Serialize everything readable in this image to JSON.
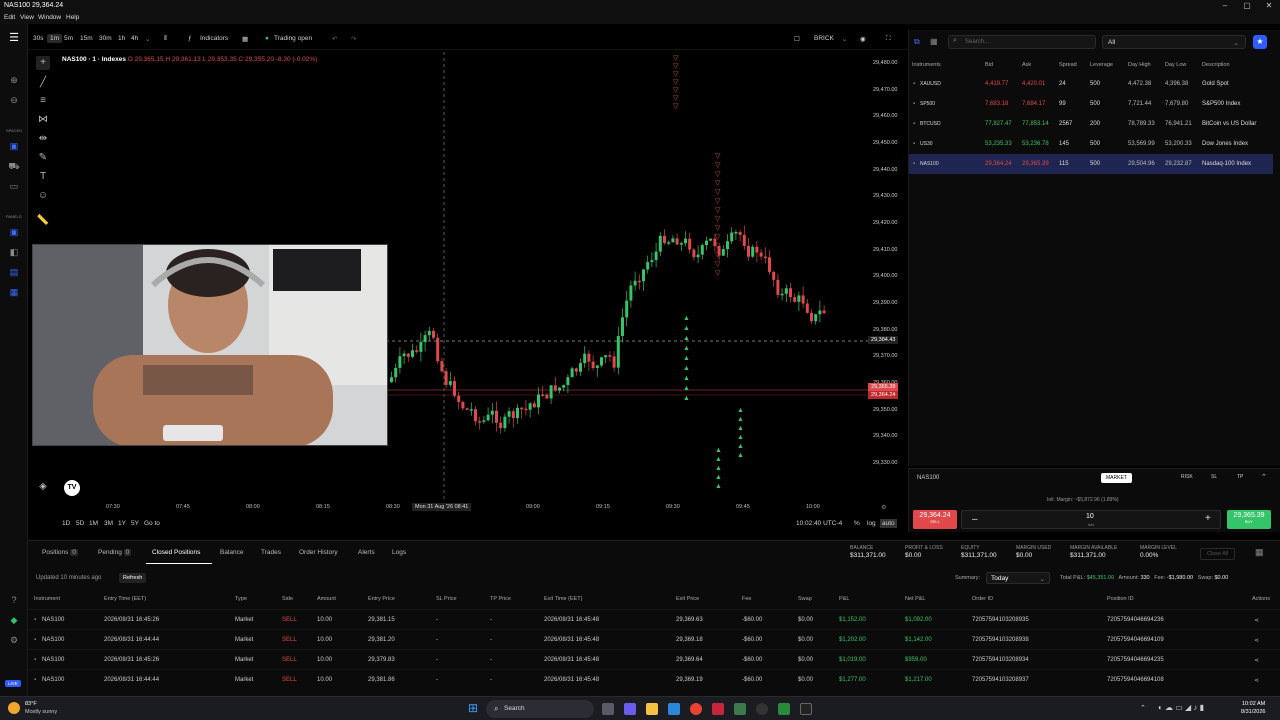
{
  "window": {
    "title": "NAS100 29,364.24"
  },
  "menu": [
    "Edit",
    "View",
    "Window",
    "Help"
  ],
  "sidebar": {
    "labels": [
      "SPACES",
      "PANELS",
      "LIVE"
    ]
  },
  "toolbar": {
    "timeframes": [
      "30s",
      "1m",
      "5m",
      "15m",
      "30m",
      "1h",
      "4h"
    ],
    "selected_timeframe": "1m",
    "indicators_label": "Indicators",
    "status_label": "Trading open",
    "chart_type": "BRICK"
  },
  "chart": {
    "symbol_label": "NAS100 · 1 · Indexes",
    "ohlc": {
      "o": "O 29,365.15",
      "h": "H 29,361.13",
      "l": "L 29,353.35",
      "c": "C 29,355.20",
      "chg": "-8.30 (-0.02%)"
    },
    "price_ticks": [
      "29,480.00",
      "29,470.00",
      "29,460.00",
      "29,450.00",
      "29,440.00",
      "29,430.00",
      "29,420.00",
      "29,410.00",
      "29,400.00",
      "29,390.00",
      "29,380.00",
      "29,370.00",
      "29,360.00",
      "29,350.00",
      "29,340.00",
      "29,330.00"
    ],
    "crosshair_price": "29,384.43",
    "ask_tag": "29,365.39",
    "bid_tag": "29,364.24",
    "time_ticks": [
      "07:30",
      "07:45",
      "08:00",
      "08:15",
      "08:30",
      "09:00",
      "09:15",
      "09:30",
      "09:45",
      "10:00"
    ],
    "crosshair_time": "Mon 31 Aug '26 08:41",
    "ranges": [
      "1D",
      "5D",
      "1M",
      "3M",
      "1Y",
      "5Y",
      "Go to"
    ],
    "clock": "10:02:40 UTC-4",
    "scale_opts": [
      "%",
      "log",
      "auto"
    ]
  },
  "watchlist": {
    "search_placeholder": "Search...",
    "filter": "All",
    "headers": [
      "Instruments",
      "Bid",
      "Ask",
      "Spread",
      "Leverage",
      "Day High",
      "Day Low",
      "Description"
    ],
    "rows": [
      {
        "symbol": "XAUUSD",
        "bid": "4,419.77",
        "ask": "4,420.01",
        "spread": "24",
        "leverage": "500",
        "high": "4,472.38",
        "low": "4,396.38",
        "desc": "Gold Spot",
        "color": "red"
      },
      {
        "symbol": "SP500",
        "bid": "7,683.18",
        "ask": "7,684.17",
        "spread": "99",
        "leverage": "500",
        "high": "7,721.44",
        "low": "7,679.80",
        "desc": "S&P500 Index",
        "color": "red"
      },
      {
        "symbol": "BTCUSD",
        "bid": "77,827.47",
        "ask": "77,853.14",
        "spread": "2567",
        "leverage": "200",
        "high": "78,789.33",
        "low": "76,941.21",
        "desc": "BitCoin vs US Dollar",
        "color": "green"
      },
      {
        "symbol": "US30",
        "bid": "53,235.33",
        "ask": "53,236.78",
        "spread": "145",
        "leverage": "500",
        "high": "53,569.99",
        "low": "53,200.33",
        "desc": "Dow Jones Index",
        "color": "green"
      },
      {
        "symbol": "NAS100",
        "bid": "29,364.24",
        "ask": "29,365.39",
        "spread": "115",
        "leverage": "500",
        "high": "29,504.96",
        "low": "29,232.87",
        "desc": "Nasdaq-100 Index",
        "color": "red"
      }
    ]
  },
  "trade": {
    "symbol": "NAS100",
    "order_type": "MARKET",
    "modes": [
      "RISK",
      "SL",
      "TP"
    ],
    "margin": "Init. Margin: ~$5,872.96 (1.89%)",
    "sell_price": "29,364.24",
    "sell_label": "SELL",
    "buy_price": "29,365.39",
    "buy_label": "BUY",
    "lots": "10",
    "lots_label": "lots"
  },
  "bottom": {
    "tabs": [
      {
        "label": "Positions",
        "count": "0"
      },
      {
        "label": "Pending",
        "count": "0"
      },
      {
        "label": "Closed Positions"
      },
      {
        "label": "Balance"
      },
      {
        "label": "Trades"
      },
      {
        "label": "Order History"
      },
      {
        "label": "Alerts"
      },
      {
        "label": "Logs"
      }
    ],
    "stats": [
      {
        "label": "BALANCE",
        "value": "$311,371.00"
      },
      {
        "label": "PROFIT & LOSS",
        "value": "$0.00"
      },
      {
        "label": "EQUITY",
        "value": "$311,371.00"
      },
      {
        "label": "MARGIN USED",
        "value": "$0.00"
      },
      {
        "label": "MARGIN AVAILABLE",
        "value": "$311,371.00"
      },
      {
        "label": "MARGIN LEVEL",
        "value": "0.00%"
      }
    ],
    "close_all": "Close All",
    "updated": "Updated 10 minutes ago",
    "refresh": "Refresh",
    "summary_label": "Summary:",
    "summary_value": "Today",
    "totals": {
      "pl_label": "Total P&L:",
      "pl": "$45,351.00",
      "amount_label": "Amount:",
      "amount": "330",
      "fee_label": "Fee:",
      "fee": "-$1,980.00",
      "swap_label": "Swap:",
      "swap": "$0.00"
    },
    "headers": [
      "Instrument",
      "Entry Time (EET)",
      "Type",
      "Side",
      "Amount",
      "Entry Price",
      "SL Price",
      "TP Price",
      "Exit Time (EET)",
      "Exit Price",
      "Fee",
      "Swap",
      "P&L",
      "Net P&L",
      "Order ID",
      "Position ID",
      "Actions"
    ],
    "rows": [
      {
        "inst": "NAS100",
        "entry_time": "2026/08/31 16:45:26",
        "type": "Market",
        "side": "SELL",
        "amount": "10.00",
        "entry": "29,381.15",
        "sl": "-",
        "tp": "-",
        "exit_time": "2026/08/31 16:45:48",
        "exit": "29,369.63",
        "fee": "-$60.00",
        "swap": "$0.00",
        "pl": "$1,152.00",
        "net": "$1,092.00",
        "order": "72057594103208935",
        "pos": "72057594046694236"
      },
      {
        "inst": "NAS100",
        "entry_time": "2026/08/31 16:44:44",
        "type": "Market",
        "side": "SELL",
        "amount": "10.00",
        "entry": "29,381.20",
        "sl": "-",
        "tp": "-",
        "exit_time": "2026/08/31 16:45:48",
        "exit": "29,369.18",
        "fee": "-$60.00",
        "swap": "$0.00",
        "pl": "$1,202.00",
        "net": "$1,142.00",
        "order": "72057594103208938",
        "pos": "72057594046694109"
      },
      {
        "inst": "NAS100",
        "entry_time": "2026/08/31 16:45:26",
        "type": "Market",
        "side": "SELL",
        "amount": "10.00",
        "entry": "29,379.83",
        "sl": "-",
        "tp": "-",
        "exit_time": "2026/08/31 16:45:48",
        "exit": "29,369.64",
        "fee": "-$60.00",
        "swap": "$0.00",
        "pl": "$1,019.00",
        "net": "$959.00",
        "order": "72057594103208934",
        "pos": "72057594046694235"
      },
      {
        "inst": "NAS100",
        "entry_time": "2026/08/31 16:44:44",
        "type": "Market",
        "side": "SELL",
        "amount": "10.00",
        "entry": "29,381.86",
        "sl": "-",
        "tp": "-",
        "exit_time": "2026/08/31 16:45:48",
        "exit": "29,369.19",
        "fee": "-$60.00",
        "swap": "$0.00",
        "pl": "$1,277.00",
        "net": "$1,217.00",
        "order": "72057594103208937",
        "pos": "72057594046694108"
      }
    ]
  },
  "taskbar": {
    "weather_temp": "83°F",
    "weather_desc": "Mostly sunny",
    "search": "Search",
    "time": "10:02 AM",
    "date": "8/31/2026"
  }
}
